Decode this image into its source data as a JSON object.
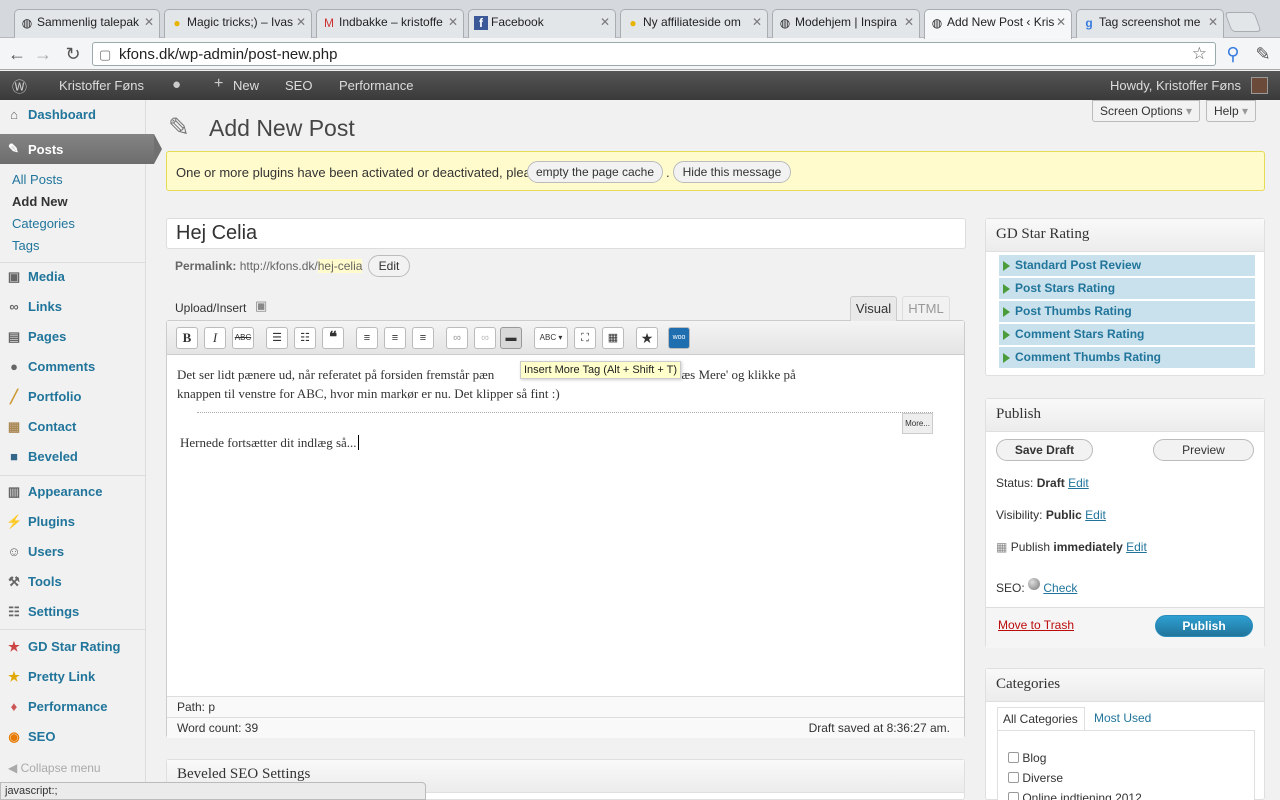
{
  "browser": {
    "tabs": [
      {
        "title": "Sammenlig talepak",
        "icon": "globe-icon"
      },
      {
        "title": "Magic tricks;) – Ivas",
        "icon": "bulb-icon"
      },
      {
        "title": "Indbakke – kristoffe",
        "icon": "gmail-icon"
      },
      {
        "title": "Facebook",
        "icon": "facebook-icon"
      },
      {
        "title": "Ny affiliateside om",
        "icon": "bulb-icon"
      },
      {
        "title": "Modehjem | Inspira",
        "icon": "globe-icon"
      },
      {
        "title": "Add New Post ‹ Kris",
        "icon": "wordpress-icon"
      },
      {
        "title": "Tag screenshot me",
        "icon": "google-icon"
      }
    ],
    "url": "kfons.dk/wp-admin/post-new.php",
    "status_text": "javascript:;"
  },
  "adminbar": {
    "site_name": "Kristoffer Føns",
    "new_label": "New",
    "seo_label": "SEO",
    "performance_label": "Performance",
    "howdy": "Howdy, Kristoffer Føns"
  },
  "menu": {
    "dashboard": "Dashboard",
    "posts": "Posts",
    "posts_sub": [
      "All Posts",
      "Add New",
      "Categories",
      "Tags"
    ],
    "media": "Media",
    "links": "Links",
    "pages": "Pages",
    "comments": "Comments",
    "portfolio": "Portfolio",
    "contact": "Contact",
    "beveled": "Beveled",
    "appearance": "Appearance",
    "plugins": "Plugins",
    "users": "Users",
    "tools": "Tools",
    "settings": "Settings",
    "gd_star_rating": "GD Star Rating",
    "pretty_link": "Pretty Link",
    "performance": "Performance",
    "seo": "SEO",
    "collapse": "Collapse menu"
  },
  "header": {
    "screen_options": "Screen Options",
    "help": "Help",
    "page_title": "Add New Post"
  },
  "notice": {
    "text": "One or more plugins have been activated or deactivated, please",
    "empty_cache": "empty the page cache",
    "dot": ".",
    "hide": "Hide this message"
  },
  "post": {
    "title": "Hej Celia",
    "permalink_label": "Permalink:",
    "permalink_base": "http://kfons.dk/",
    "permalink_slug": "hej-celia",
    "edit_label": "Edit",
    "upload_insert": "Upload/Insert",
    "tab_visual": "Visual",
    "tab_html": "HTML",
    "content_p1": "Det ser lidt pænere ud, når referatet på forsiden fremstår pæn",
    "content_p1_end": "an altid skrive 'Læs Mere' og klikke på",
    "content_p2": "knappen til venstre for ABC, hvor min markør er nu. Det klipper så fint :)",
    "more_label": "More...",
    "content_p3": "Hernede fortsætter dit indlæg så...",
    "tooltip": "Insert More Tag (Alt + Shift + T)",
    "path_label": "Path: p",
    "word_count": "Word count: 39",
    "draft_saved": "Draft saved at 8:36:27 am."
  },
  "beveled_box": {
    "title": "Beveled SEO Settings"
  },
  "gd_box": {
    "title": "GD Star Rating",
    "items": [
      "Standard Post Review",
      "Post Stars Rating",
      "Post Thumbs Rating",
      "Comment Stars Rating",
      "Comment Thumbs Rating"
    ]
  },
  "publish_box": {
    "title": "Publish",
    "save_draft": "Save Draft",
    "preview": "Preview",
    "status_label": "Status:",
    "status_value": "Draft",
    "visibility_label": "Visibility:",
    "visibility_value": "Public",
    "publish_label": "Publish",
    "publish_value": "immediately",
    "edit": "Edit",
    "seo_label": "SEO:",
    "seo_check": "Check",
    "trash": "Move to Trash",
    "publish_button": "Publish"
  },
  "categories_box": {
    "title": "Categories",
    "tab_all": "All Categories",
    "tab_used": "Most Used",
    "items": [
      "Blog",
      "Diverse",
      "Online indtjening 2012"
    ]
  }
}
